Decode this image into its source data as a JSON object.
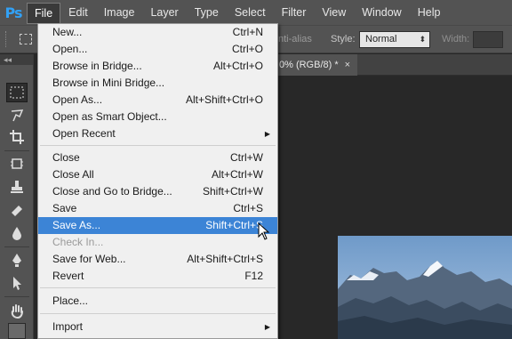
{
  "app": {
    "logo": "Ps"
  },
  "menubar": {
    "items": [
      {
        "label": "File",
        "active": true
      },
      {
        "label": "Edit"
      },
      {
        "label": "Image"
      },
      {
        "label": "Layer"
      },
      {
        "label": "Type"
      },
      {
        "label": "Select"
      },
      {
        "label": "Filter"
      },
      {
        "label": "View"
      },
      {
        "label": "Window"
      },
      {
        "label": "Help"
      }
    ]
  },
  "options": {
    "antialias_label": "nti-alias",
    "style_label": "Style:",
    "style_value": "Normal",
    "width_label": "Width:"
  },
  "toolbox": {
    "collapse_label": "◂◂"
  },
  "document": {
    "tab_title": "0% (RGB/8) *",
    "close": "×"
  },
  "file_menu": {
    "items": [
      {
        "label": "New...",
        "shortcut": "Ctrl+N"
      },
      {
        "label": "Open...",
        "shortcut": "Ctrl+O"
      },
      {
        "label": "Browse in Bridge...",
        "shortcut": "Alt+Ctrl+O"
      },
      {
        "label": "Browse in Mini Bridge...",
        "shortcut": ""
      },
      {
        "label": "Open As...",
        "shortcut": "Alt+Shift+Ctrl+O"
      },
      {
        "label": "Open as Smart Object...",
        "shortcut": ""
      },
      {
        "label": "Open Recent",
        "shortcut": "",
        "submenu": true
      },
      {
        "label": "Close",
        "shortcut": "Ctrl+W"
      },
      {
        "label": "Close All",
        "shortcut": "Alt+Ctrl+W"
      },
      {
        "label": "Close and Go to Bridge...",
        "shortcut": "Shift+Ctrl+W"
      },
      {
        "label": "Save",
        "shortcut": "Ctrl+S"
      },
      {
        "label": "Save As...",
        "shortcut": "Shift+Ctrl+S",
        "highlighted": true
      },
      {
        "label": "Check In...",
        "shortcut": "",
        "disabled": true
      },
      {
        "label": "Save for Web...",
        "shortcut": "Alt+Shift+Ctrl+S"
      },
      {
        "label": "Revert",
        "shortcut": "F12"
      },
      {
        "label": "Place...",
        "shortcut": ""
      },
      {
        "label": "Import",
        "shortcut": "",
        "submenu": true
      }
    ]
  },
  "colors": {
    "menubar_bg": "#535353",
    "highlight": "#3c84d6",
    "menu_bg": "#f0f0f0",
    "logo": "#32a1f5"
  }
}
